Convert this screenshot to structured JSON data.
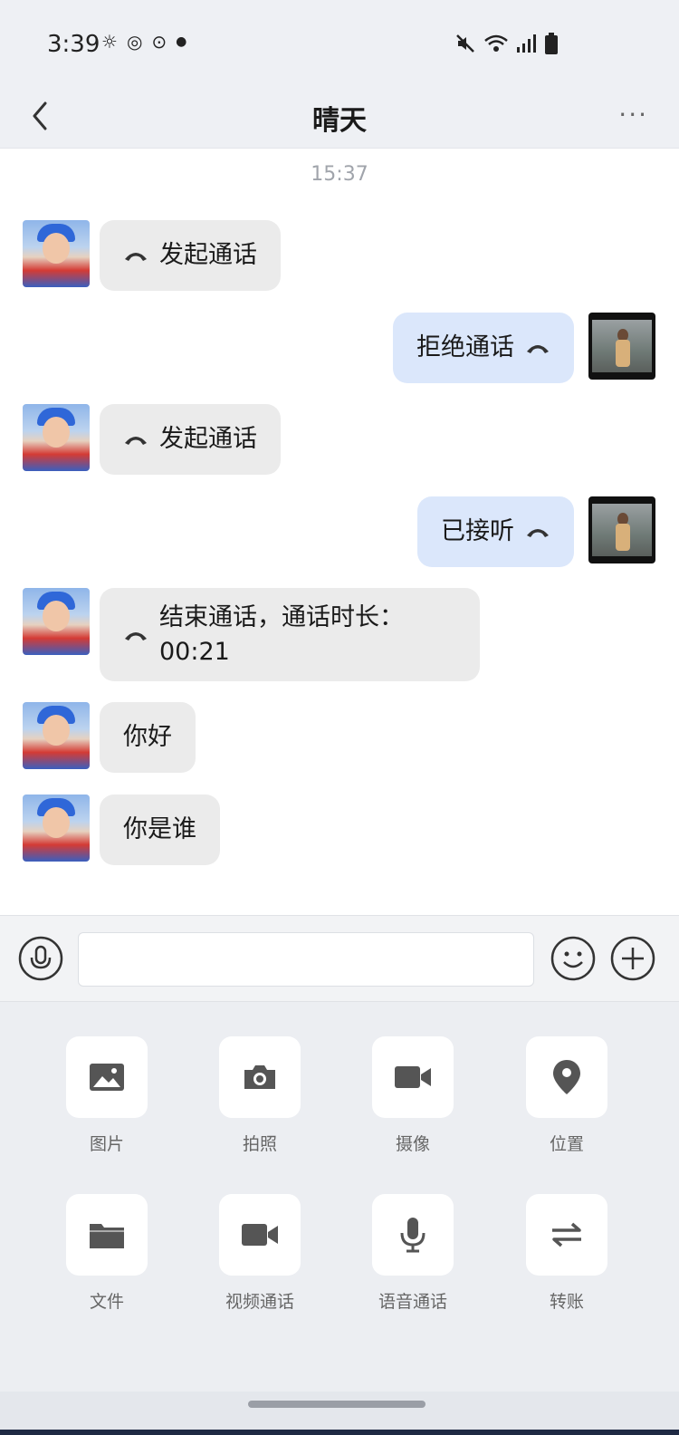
{
  "status_bar": {
    "time": "3:39",
    "left_icons": [
      "weather-icon",
      "sync-icon",
      "location-icon",
      "dot-icon"
    ],
    "right_icons": [
      "mute-icon",
      "wifi-icon",
      "signal-icon",
      "battery-icon"
    ]
  },
  "header": {
    "title": "晴天",
    "more": "···"
  },
  "chat": {
    "timestamp": "15:37",
    "messages": [
      {
        "side": "in",
        "text": "发起通话",
        "icon": "phone-icon"
      },
      {
        "side": "out",
        "text": "拒绝通话",
        "icon": "phone-icon"
      },
      {
        "side": "in",
        "text": "发起通话",
        "icon": "phone-icon"
      },
      {
        "side": "out",
        "text": "已接听",
        "icon": "phone-icon"
      },
      {
        "side": "in",
        "text_line1": "结束通话，通话时长：",
        "text_line2": "00:21",
        "icon": "phone-icon"
      },
      {
        "side": "in",
        "text": "你好"
      },
      {
        "side": "in",
        "text": "你是谁"
      }
    ]
  },
  "input": {
    "value": "",
    "placeholder": ""
  },
  "tools": [
    {
      "label": "图片",
      "icon": "image-icon"
    },
    {
      "label": "拍照",
      "icon": "camera-icon"
    },
    {
      "label": "摄像",
      "icon": "video-icon"
    },
    {
      "label": "位置",
      "icon": "location-pin-icon"
    },
    {
      "label": "文件",
      "icon": "folder-icon"
    },
    {
      "label": "视频通话",
      "icon": "video-call-icon"
    },
    {
      "label": "语音通话",
      "icon": "microphone-icon"
    },
    {
      "label": "转账",
      "icon": "transfer-icon"
    }
  ],
  "colors": {
    "incoming_bubble": "#ebebeb",
    "outgoing_bubble": "#dbe7fb",
    "icon_gray": "#555555"
  }
}
